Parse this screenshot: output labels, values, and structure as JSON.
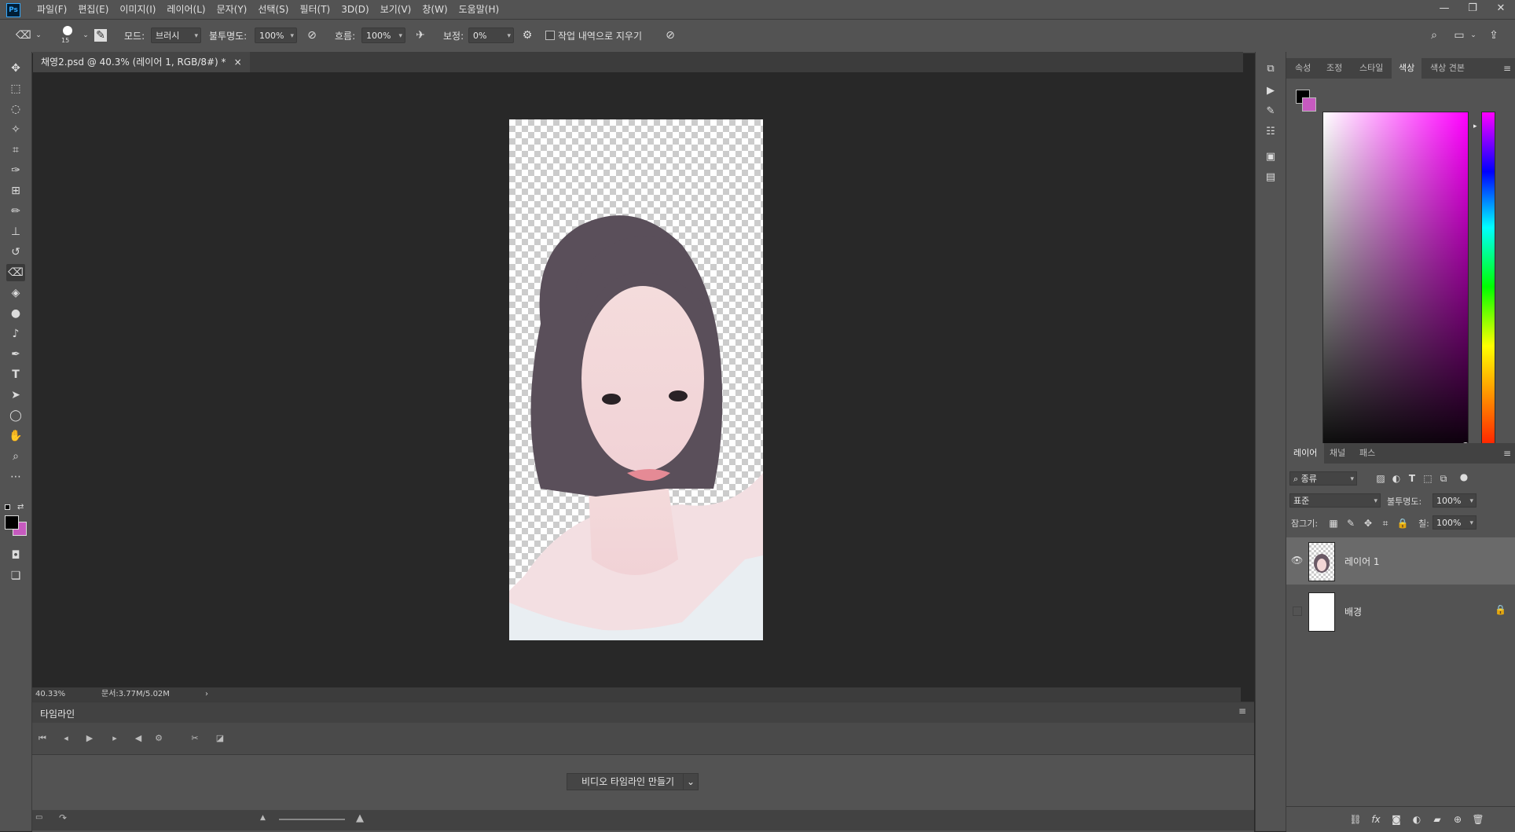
{
  "app": {
    "logo": "Ps",
    "menus": [
      "파일(F)",
      "편집(E)",
      "이미지(I)",
      "레이어(L)",
      "문자(Y)",
      "선택(S)",
      "필터(T)",
      "3D(D)",
      "보기(V)",
      "창(W)",
      "도움말(H)"
    ],
    "window_controls": [
      "minimize-icon",
      "restore-icon",
      "close-icon"
    ]
  },
  "options": {
    "brush_size": "15",
    "mode_label": "모드:",
    "mode_value": "브러시",
    "opacity_label": "불투명도:",
    "opacity_value": "100%",
    "flow_label": "흐름:",
    "flow_value": "100%",
    "smoothing_label": "보정:",
    "smoothing_value": "0%",
    "erase_history_label": "작업 내역으로 지우기"
  },
  "document": {
    "tab_title": "채영2.psd @ 40.3% (레이어 1, RGB/8#) *",
    "close": "×"
  },
  "status": {
    "zoom": "40.33%",
    "doc_size": "문서:3.77M/5.02M",
    "arrow": "›"
  },
  "timeline": {
    "title": "타임라인",
    "create_button": "비디오 타임라인 만들기"
  },
  "color_panel": {
    "tabs": [
      "속성",
      "조정",
      "스타일",
      "색상",
      "색상 견본"
    ],
    "active_tab": 3,
    "foreground": "#000000",
    "background": "#c65abf"
  },
  "layers_panel": {
    "tabs": [
      "레이어",
      "채널",
      "패스"
    ],
    "filter_kind": "종류",
    "blend_mode": "표준",
    "opacity_label": "불투명도:",
    "opacity_value": "100%",
    "lock_label": "잠그기:",
    "fill_label": "칠:",
    "fill_value": "100%",
    "layers": [
      {
        "name": "레이어 1",
        "visible": true,
        "selected": true
      },
      {
        "name": "배경",
        "visible": false,
        "selected": false,
        "locked": true
      }
    ]
  }
}
